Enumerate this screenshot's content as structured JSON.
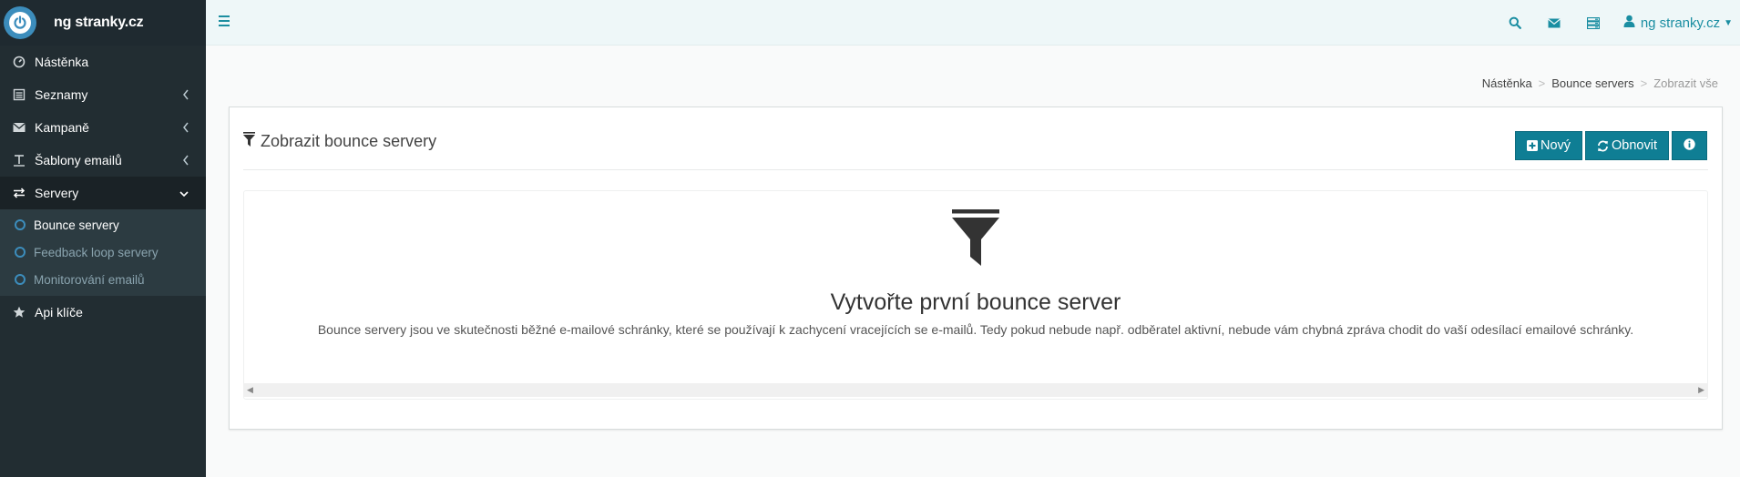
{
  "brand": {
    "title": "ng stranky.cz",
    "logo_icon": "power-icon"
  },
  "sidebar": {
    "items": [
      {
        "label": "Nástěnka",
        "icon": "dashboard-icon"
      },
      {
        "label": "Seznamy",
        "icon": "list-icon"
      },
      {
        "label": "Kampaně",
        "icon": "envelope-icon"
      },
      {
        "label": "Šablony emailů",
        "icon": "text-icon"
      },
      {
        "label": "Servery",
        "icon": "exchange-icon"
      },
      {
        "label": "Api klíče",
        "icon": "star-icon"
      }
    ],
    "submenu": [
      {
        "label": "Bounce servery"
      },
      {
        "label": "Feedback loop servery"
      },
      {
        "label": "Monitorování emailů"
      }
    ]
  },
  "topbar": {
    "user_label": "ng stranky.cz",
    "icons": [
      "search-icon",
      "envelope-icon",
      "server-icon",
      "user-icon"
    ]
  },
  "breadcrumb": [
    "Nástěnka",
    "Bounce servers",
    "Zobrazit vše"
  ],
  "box": {
    "title": "Zobrazit bounce servery",
    "buttons": {
      "new": "Nový",
      "refresh": "Obnovit"
    }
  },
  "empty": {
    "title": "Vytvořte první bounce server",
    "text": "Bounce servery jsou ve skutečnosti běžné e-mailové schránky, které se používají k zachycení vracejících se e-mailů. Tedy pokud nebude např. odběratel aktivní, nebude vám chybná zpráva chodit do vaší odesílací emailové schránky."
  },
  "colors": {
    "accent": "#0f7e94",
    "sidebar": "#222d32",
    "link": "#1a8ea2"
  }
}
